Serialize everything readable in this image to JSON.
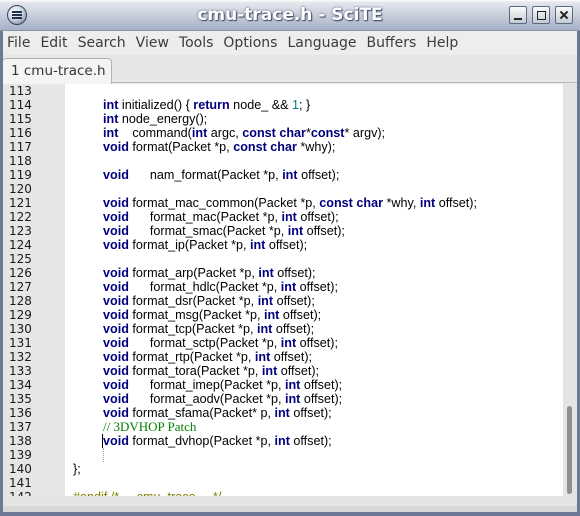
{
  "window": {
    "title": "cmu-trace.h - SciTE",
    "menu_icon": "window-menu-icon",
    "controls": [
      "minimize-icon",
      "maximize-icon",
      "close-icon"
    ]
  },
  "menubar": {
    "items": [
      "File",
      "Edit",
      "Search",
      "View",
      "Tools",
      "Options",
      "Language",
      "Buffers",
      "Help"
    ]
  },
  "tabs": [
    {
      "label": "1 cmu-trace.h",
      "active": true
    }
  ],
  "colors": {
    "keyword": "#00007f",
    "number": "#007f7f",
    "comment": "#007f00",
    "preprocessor": "#7f7f00",
    "gutter": "#e6e6e5"
  },
  "editor": {
    "caret_line": 138,
    "lines": [
      {
        "n": "113",
        "segs": []
      },
      {
        "n": "114",
        "segs": [
          [
            "k",
            "int"
          ],
          [
            "t",
            " initialized() { "
          ],
          [
            "k",
            "return"
          ],
          [
            "t",
            " node_ && "
          ],
          [
            "n",
            "1"
          ],
          [
            "t",
            "; }"
          ]
        ]
      },
      {
        "n": "115",
        "segs": [
          [
            "k",
            "int"
          ],
          [
            "t",
            " node_energy();"
          ]
        ]
      },
      {
        "n": "116",
        "segs": [
          [
            "k",
            "int"
          ],
          [
            "t",
            "    command("
          ],
          [
            "k",
            "int"
          ],
          [
            "t",
            " argc, "
          ],
          [
            "k",
            "const char"
          ],
          [
            "t",
            "*"
          ],
          [
            "k",
            "const"
          ],
          [
            "t",
            "* argv);"
          ]
        ]
      },
      {
        "n": "117",
        "segs": [
          [
            "k",
            "void"
          ],
          [
            "t",
            " format(Packet *p, "
          ],
          [
            "k",
            "const char"
          ],
          [
            "t",
            " *why);"
          ]
        ]
      },
      {
        "n": "118",
        "segs": []
      },
      {
        "n": "119",
        "segs": [
          [
            "k",
            "void"
          ],
          [
            "t",
            "      nam_format(Packet *p, "
          ],
          [
            "k",
            "int"
          ],
          [
            "t",
            " offset);"
          ]
        ]
      },
      {
        "n": "120",
        "segs": []
      },
      {
        "n": "121",
        "segs": [
          [
            "k",
            "void"
          ],
          [
            "t",
            " format_mac_common(Packet *p, "
          ],
          [
            "k",
            "const char"
          ],
          [
            "t",
            " *why, "
          ],
          [
            "k",
            "int"
          ],
          [
            "t",
            " offset);"
          ]
        ]
      },
      {
        "n": "122",
        "segs": [
          [
            "k",
            "void"
          ],
          [
            "t",
            "      format_mac(Packet *p, "
          ],
          [
            "k",
            "int"
          ],
          [
            "t",
            " offset);"
          ]
        ]
      },
      {
        "n": "123",
        "segs": [
          [
            "k",
            "void"
          ],
          [
            "t",
            "      format_smac(Packet *p, "
          ],
          [
            "k",
            "int"
          ],
          [
            "t",
            " offset);"
          ]
        ]
      },
      {
        "n": "124",
        "segs": [
          [
            "k",
            "void"
          ],
          [
            "t",
            " format_ip(Packet *p, "
          ],
          [
            "k",
            "int"
          ],
          [
            "t",
            " offset);"
          ]
        ]
      },
      {
        "n": "125",
        "segs": []
      },
      {
        "n": "126",
        "segs": [
          [
            "k",
            "void"
          ],
          [
            "t",
            " format_arp(Packet *p, "
          ],
          [
            "k",
            "int"
          ],
          [
            "t",
            " offset);"
          ]
        ]
      },
      {
        "n": "127",
        "segs": [
          [
            "k",
            "void"
          ],
          [
            "t",
            "      format_hdlc(Packet *p, "
          ],
          [
            "k",
            "int"
          ],
          [
            "t",
            " offset);"
          ]
        ]
      },
      {
        "n": "128",
        "segs": [
          [
            "k",
            "void"
          ],
          [
            "t",
            " format_dsr(Packet *p, "
          ],
          [
            "k",
            "int"
          ],
          [
            "t",
            " offset);"
          ]
        ]
      },
      {
        "n": "129",
        "segs": [
          [
            "k",
            "void"
          ],
          [
            "t",
            " format_msg(Packet *p, "
          ],
          [
            "k",
            "int"
          ],
          [
            "t",
            " offset);"
          ]
        ]
      },
      {
        "n": "130",
        "segs": [
          [
            "k",
            "void"
          ],
          [
            "t",
            " format_tcp(Packet *p, "
          ],
          [
            "k",
            "int"
          ],
          [
            "t",
            " offset);"
          ]
        ]
      },
      {
        "n": "131",
        "segs": [
          [
            "k",
            "void"
          ],
          [
            "t",
            "      format_sctp(Packet *p, "
          ],
          [
            "k",
            "int"
          ],
          [
            "t",
            " offset);"
          ]
        ]
      },
      {
        "n": "132",
        "segs": [
          [
            "k",
            "void"
          ],
          [
            "t",
            " format_rtp(Packet *p, "
          ],
          [
            "k",
            "int"
          ],
          [
            "t",
            " offset);"
          ]
        ]
      },
      {
        "n": "133",
        "segs": [
          [
            "k",
            "void"
          ],
          [
            "t",
            " format_tora(Packet *p, "
          ],
          [
            "k",
            "int"
          ],
          [
            "t",
            " offset);"
          ]
        ]
      },
      {
        "n": "134",
        "segs": [
          [
            "k",
            "void"
          ],
          [
            "t",
            "      format_imep(Packet *p, "
          ],
          [
            "k",
            "int"
          ],
          [
            "t",
            " offset);"
          ]
        ]
      },
      {
        "n": "135",
        "segs": [
          [
            "k",
            "void"
          ],
          [
            "t",
            "      format_aodv(Packet *p, "
          ],
          [
            "k",
            "int"
          ],
          [
            "t",
            " offset);"
          ]
        ]
      },
      {
        "n": "136",
        "segs": [
          [
            "k",
            "void"
          ],
          [
            "t",
            " format_sfama(Packet* p, "
          ],
          [
            "k",
            "int"
          ],
          [
            "t",
            " offset);"
          ]
        ]
      },
      {
        "n": "137",
        "segs": [
          [
            "c",
            "// 3DVHOP Patch"
          ]
        ]
      },
      {
        "n": "138",
        "segs": [
          [
            "k",
            "void"
          ],
          [
            "t",
            " format_dvhop(Packet *p, "
          ],
          [
            "k",
            "int"
          ],
          [
            "t",
            " offset);"
          ]
        ]
      },
      {
        "n": "139",
        "segs": []
      },
      {
        "n": "140",
        "segs": [
          [
            "t",
            "};"
          ]
        ],
        "indent": 0
      },
      {
        "n": "141",
        "segs": []
      },
      {
        "n": "142",
        "segs": [
          [
            "p",
            "#endif /* __cmu_trace__ */"
          ]
        ],
        "indent": 0
      }
    ]
  }
}
